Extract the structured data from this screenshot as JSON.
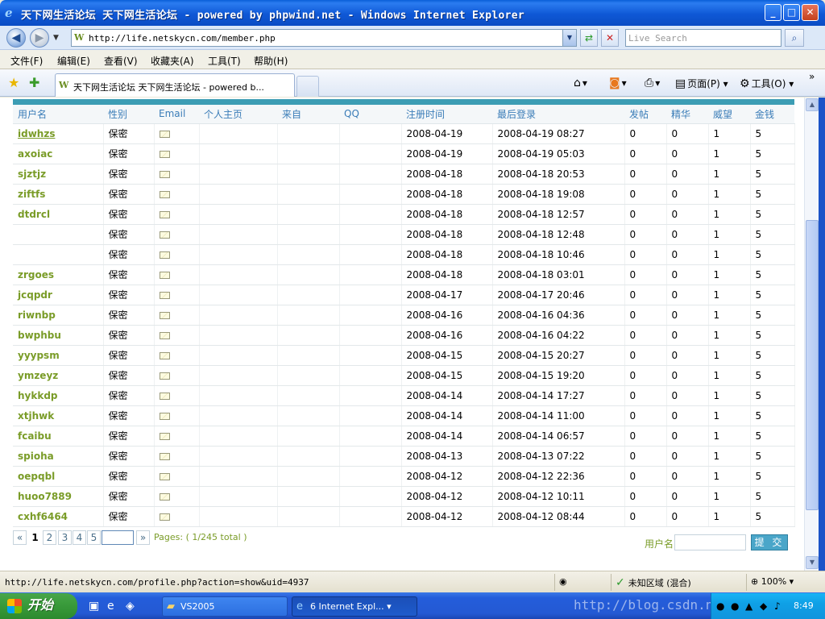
{
  "window": {
    "title": "天下网生活论坛 天下网生活论坛 - powered by phpwind.net - Windows Internet Explorer",
    "minimize": "_",
    "maximize": "□",
    "close": "✕"
  },
  "address": {
    "url": "http://life.netskycn.com/member.php",
    "search_placeholder": "Live Search"
  },
  "menu": [
    "文件(F)",
    "编辑(E)",
    "查看(V)",
    "收藏夹(A)",
    "工具(T)",
    "帮助(H)"
  ],
  "tab": {
    "title": "天下网生活论坛 天下网生活论坛 - powered b..."
  },
  "commands": {
    "page": "页面(P)",
    "tools": "工具(O)"
  },
  "table": {
    "headers": [
      "用户名",
      "性别",
      "Email",
      "个人主页",
      "来自",
      "QQ",
      "注册时间",
      "最后登录",
      "发帖",
      "精华",
      "威望",
      "金钱"
    ],
    "rows": [
      {
        "name": "idwhzs",
        "gender": "保密",
        "reg": "2008-04-19",
        "last": "2008-04-19 08:27",
        "posts": "0",
        "digest": "0",
        "rep": "1",
        "money": "5"
      },
      {
        "name": "axoiac",
        "gender": "保密",
        "reg": "2008-04-19",
        "last": "2008-04-19 05:03",
        "posts": "0",
        "digest": "0",
        "rep": "1",
        "money": "5"
      },
      {
        "name": "sjztjz",
        "gender": "保密",
        "reg": "2008-04-18",
        "last": "2008-04-18 20:53",
        "posts": "0",
        "digest": "0",
        "rep": "1",
        "money": "5"
      },
      {
        "name": "ziftfs",
        "gender": "保密",
        "reg": "2008-04-18",
        "last": "2008-04-18 19:08",
        "posts": "0",
        "digest": "0",
        "rep": "1",
        "money": "5"
      },
      {
        "name": "dtdrcl",
        "gender": "保密",
        "reg": "2008-04-18",
        "last": "2008-04-18 12:57",
        "posts": "0",
        "digest": "0",
        "rep": "1",
        "money": "5"
      },
      {
        "name": "",
        "gender": "保密",
        "reg": "2008-04-18",
        "last": "2008-04-18 12:48",
        "posts": "0",
        "digest": "0",
        "rep": "1",
        "money": "5"
      },
      {
        "name": "",
        "gender": "保密",
        "reg": "2008-04-18",
        "last": "2008-04-18 10:46",
        "posts": "0",
        "digest": "0",
        "rep": "1",
        "money": "5"
      },
      {
        "name": "zrgoes",
        "gender": "保密",
        "reg": "2008-04-18",
        "last": "2008-04-18 03:01",
        "posts": "0",
        "digest": "0",
        "rep": "1",
        "money": "5"
      },
      {
        "name": "jcqpdr",
        "gender": "保密",
        "reg": "2008-04-17",
        "last": "2008-04-17 20:46",
        "posts": "0",
        "digest": "0",
        "rep": "1",
        "money": "5"
      },
      {
        "name": "riwnbp",
        "gender": "保密",
        "reg": "2008-04-16",
        "last": "2008-04-16 04:36",
        "posts": "0",
        "digest": "0",
        "rep": "1",
        "money": "5"
      },
      {
        "name": "bwphbu",
        "gender": "保密",
        "reg": "2008-04-16",
        "last": "2008-04-16 04:22",
        "posts": "0",
        "digest": "0",
        "rep": "1",
        "money": "5"
      },
      {
        "name": "yyypsm",
        "gender": "保密",
        "reg": "2008-04-15",
        "last": "2008-04-15 20:27",
        "posts": "0",
        "digest": "0",
        "rep": "1",
        "money": "5"
      },
      {
        "name": "ymzeyz",
        "gender": "保密",
        "reg": "2008-04-15",
        "last": "2008-04-15 19:20",
        "posts": "0",
        "digest": "0",
        "rep": "1",
        "money": "5"
      },
      {
        "name": "hykkdp",
        "gender": "保密",
        "reg": "2008-04-14",
        "last": "2008-04-14 17:27",
        "posts": "0",
        "digest": "0",
        "rep": "1",
        "money": "5"
      },
      {
        "name": "xtjhwk",
        "gender": "保密",
        "reg": "2008-04-14",
        "last": "2008-04-14 11:00",
        "posts": "0",
        "digest": "0",
        "rep": "1",
        "money": "5"
      },
      {
        "name": "fcaibu",
        "gender": "保密",
        "reg": "2008-04-14",
        "last": "2008-04-14 06:57",
        "posts": "0",
        "digest": "0",
        "rep": "1",
        "money": "5"
      },
      {
        "name": "spioha",
        "gender": "保密",
        "reg": "2008-04-13",
        "last": "2008-04-13 07:22",
        "posts": "0",
        "digest": "0",
        "rep": "1",
        "money": "5"
      },
      {
        "name": "oepqbl",
        "gender": "保密",
        "reg": "2008-04-12",
        "last": "2008-04-12 22:36",
        "posts": "0",
        "digest": "0",
        "rep": "1",
        "money": "5"
      },
      {
        "name": "huoo7889",
        "gender": "保密",
        "reg": "2008-04-12",
        "last": "2008-04-12 10:11",
        "posts": "0",
        "digest": "0",
        "rep": "1",
        "money": "5"
      },
      {
        "name": "cxhf6464",
        "gender": "保密",
        "reg": "2008-04-12",
        "last": "2008-04-12 08:44",
        "posts": "0",
        "digest": "0",
        "rep": "1",
        "money": "5"
      }
    ]
  },
  "pager": {
    "first": "«",
    "pages": [
      "1",
      "2",
      "3",
      "4",
      "5"
    ],
    "next": "»",
    "info": "Pages: ( 1/245 total )"
  },
  "search": {
    "label": "用户名",
    "submit": "提 交"
  },
  "status": {
    "url": "http://life.netskycn.com/profile.php?action=show&uid=4937",
    "zone": "未知区域 (混合)",
    "zoom": "100%"
  },
  "taskbar": {
    "start": "开始",
    "tasks": [
      "VS2005",
      "6 Internet Expl..."
    ],
    "watermark": "http://blog.csdn.net/",
    "clock": "8:49"
  }
}
